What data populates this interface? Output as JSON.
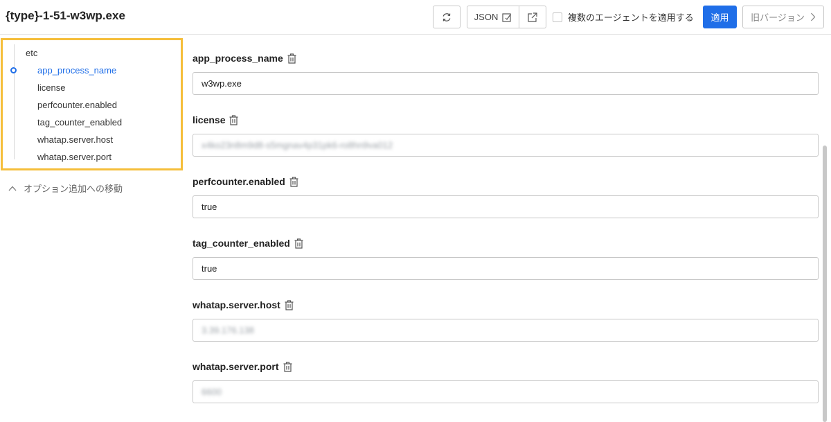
{
  "header": {
    "title": "{type}-1-51-w3wp.exe",
    "json_label": "JSON",
    "multi_agent_label": "複数のエージェントを適用する",
    "apply_label": "適用",
    "old_version_label": "旧バージョン"
  },
  "tree": {
    "root": "etc",
    "items": [
      {
        "label": "app_process_name",
        "active": true
      },
      {
        "label": "license"
      },
      {
        "label": "perfcounter.enabled"
      },
      {
        "label": "tag_counter_enabled"
      },
      {
        "label": "whatap.server.host"
      },
      {
        "label": "whatap.server.port"
      }
    ]
  },
  "move_option_label": "オプション追加への移動",
  "fields": [
    {
      "name": "app_process_name",
      "value": "w3wp.exe"
    },
    {
      "name": "license",
      "value": "x4ko23n8m9d8-s5mgnav4p31pk6-ro8hn9va012"
    },
    {
      "name": "perfcounter.enabled",
      "value": "true"
    },
    {
      "name": "tag_counter_enabled",
      "value": "true"
    },
    {
      "name": "whatap.server.host",
      "value": "3.39.176.138"
    },
    {
      "name": "whatap.server.port",
      "value": "6600"
    }
  ],
  "colors": {
    "accent": "#1f6ee8",
    "highlight_border": "#f5be3a"
  }
}
